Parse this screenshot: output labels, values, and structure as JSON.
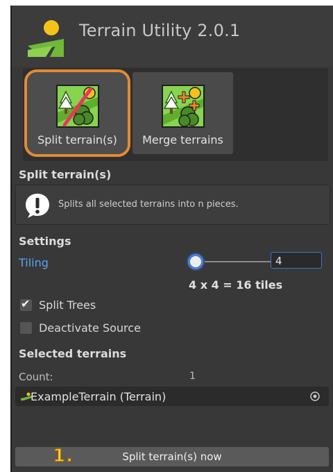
{
  "header": {
    "title": "Terrain Utility 2.0.1",
    "logo_icon": "terrain-sun-logo-icon"
  },
  "tools": [
    {
      "label": "Split terrain(s)",
      "icon": "split-terrain-icon",
      "selected": true
    },
    {
      "label": "Merge terrains",
      "icon": "merge-terrains-icon",
      "selected": false
    }
  ],
  "split_section": {
    "title": "Split terrain(s)",
    "help_icon": "exclamation-bubble-icon",
    "help_text": "Splits all selected terrains into n pieces."
  },
  "settings": {
    "title": "Settings",
    "tiling_label": "Tiling",
    "tiling_value": "4",
    "tiles_readout": "4 x 4 = 16 tiles",
    "split_trees": {
      "label": "Split Trees",
      "checked": true
    },
    "deactivate_source": {
      "label": "Deactivate Source",
      "checked": false
    }
  },
  "selected_terrains": {
    "title": "Selected terrains",
    "count_label": "Count:",
    "count_value": "1",
    "items": [
      {
        "name": "ExampleTerrain (Terrain)",
        "icon": "terrain-icon"
      }
    ],
    "picker_icon": "object-picker-icon"
  },
  "actions": {
    "run_label": "Split terrain(s) now",
    "step_badge": "1."
  },
  "colors": {
    "panel_bg": "#383838",
    "accent_blue": "#57a3f3",
    "selection_orange": "#e28a33",
    "badge_yellow": "#f4cd3f"
  }
}
